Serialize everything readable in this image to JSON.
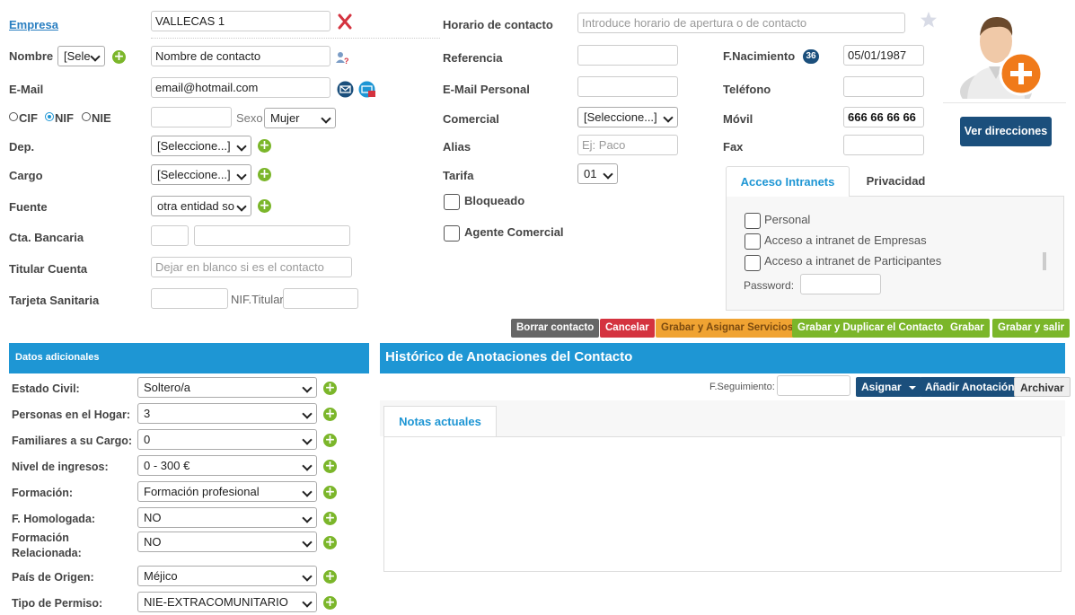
{
  "header": {
    "empresa_label": "Empresa",
    "empresa_value": "VALLECAS 1",
    "horario_label": "Horario de contacto",
    "horario_placeholder": "Introduce horario de apertura o de contacto"
  },
  "left": {
    "nombre_label": "Nombre",
    "nombre_title_value": "[Sele",
    "nombre_placeholder": "Nombre de contacto",
    "email_label": "E-Mail",
    "email_value": "email@hotmail.com",
    "doc_cif": "CIF",
    "doc_nif": "NIF",
    "doc_nie": "NIE",
    "sexo_label": "Sexo",
    "sexo_value": "Mujer",
    "dep_label": "Dep.",
    "dep_value": "[Seleccione...]",
    "cargo_label": "Cargo",
    "cargo_value": "[Seleccione...]",
    "fuente_label": "Fuente",
    "fuente_value": "otra entidad so",
    "cta_label": "Cta. Bancaria",
    "titular_label": "Titular Cuenta",
    "titular_placeholder": "Dejar en blanco si es el contacto",
    "tarjeta_label": "Tarjeta Sanitaria",
    "nif_titular_label": "NIF.Titular"
  },
  "middle": {
    "referencia_label": "Referencia",
    "email_personal_label": "E-Mail Personal",
    "comercial_label": "Comercial",
    "comercial_value": "[Seleccione...]",
    "alias_label": "Alias",
    "alias_placeholder": "Ej: Paco",
    "tarifa_label": "Tarifa",
    "tarifa_value": "01",
    "bloqueado_label": "Bloqueado",
    "agente_label": "Agente Comercial"
  },
  "right": {
    "fnac_label": "F.Nacimiento",
    "age_badge": "36",
    "fnac_value": "05/01/1987",
    "telefono_label": "Teléfono",
    "movil_label": "Móvil",
    "movil_value": "666 66 66 66",
    "fax_label": "Fax",
    "ver_direcciones": "Ver direcciones"
  },
  "intranet": {
    "tab_acceso": "Acceso Intranets",
    "tab_privacidad": "Privacidad",
    "options": [
      "Personal",
      "Acceso a intranet de Empresas",
      "Acceso a intranet de Participantes"
    ],
    "password_label": "Password:"
  },
  "actions": {
    "borrar": "Borrar contacto",
    "cancelar": "Cancelar",
    "grabar_asignar": "Grabar y Asignar Servicios",
    "grabar_duplicar": "Grabar y Duplicar el Contacto",
    "grabar": "Grabar",
    "grabar_salir": "Grabar y salir"
  },
  "datos": {
    "title": "Datos adicionales",
    "rows": [
      {
        "label": "Estado Civil:",
        "value": "Soltero/a"
      },
      {
        "label": "Personas en el Hogar:",
        "value": "3"
      },
      {
        "label": "Familiares a su Cargo:",
        "value": "0"
      },
      {
        "label": "Nivel de ingresos:",
        "value": "0 - 300 €"
      },
      {
        "label": "Formación:",
        "value": "Formación profesional"
      },
      {
        "label": "F. Homologada:",
        "value": "NO"
      },
      {
        "label": "Formación Relacionada:",
        "value": "NO"
      },
      {
        "label": "País de Origen:",
        "value": "Méjico"
      },
      {
        "label": "Tipo de Permiso:",
        "value": "NIE-EXTRACOMUNITARIO"
      }
    ]
  },
  "historico": {
    "title": "Histórico de Anotaciones del Contacto",
    "fseg_label": "F.Seguimiento:",
    "asignar": "Asignar",
    "anadir": "Añadir Anotación",
    "archivar": "Archivar",
    "tab_notas": "Notas actuales"
  },
  "colors": {
    "primary": "#1e96d4",
    "dark_blue": "#1b4f7c",
    "green": "#7bb62a",
    "red": "#d4333f",
    "orange": "#f0a332",
    "gray": "#666666"
  }
}
